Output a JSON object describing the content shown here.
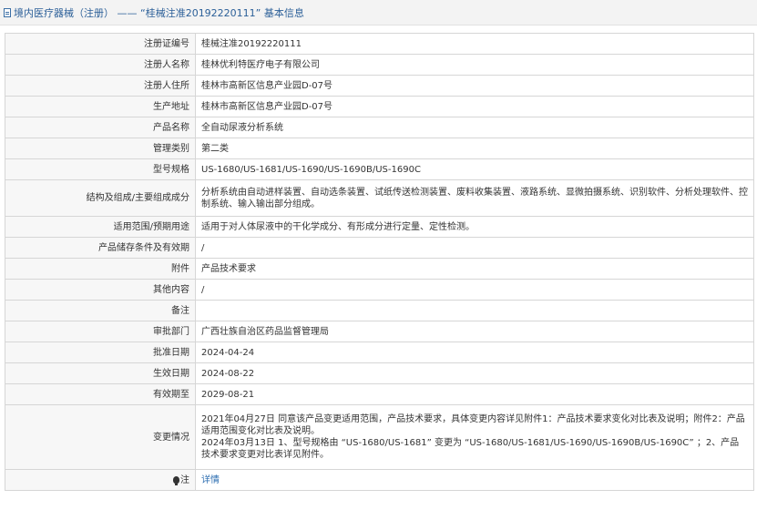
{
  "header": {
    "title": "境内医疗器械（注册） —— “桂械注准20192220111” 基本信息"
  },
  "rows": [
    {
      "label": "注册证编号",
      "value": "桂械注准20192220111"
    },
    {
      "label": "注册人名称",
      "value": "桂林优利特医疗电子有限公司"
    },
    {
      "label": "注册人住所",
      "value": "桂林市高新区信息产业园D-07号"
    },
    {
      "label": "生产地址",
      "value": "桂林市高新区信息产业园D-07号"
    },
    {
      "label": "产品名称",
      "value": "全自动尿液分析系统"
    },
    {
      "label": "管理类别",
      "value": "第二类"
    },
    {
      "label": "型号规格",
      "value": "US-1680/US-1681/US-1690/US-1690B/US-1690C"
    },
    {
      "label": "结构及组成/主要组成成分",
      "value": "分析系统由自动进样装置、自动选条装置、试纸传送检测装置、废料收集装置、液路系统、显微拍摄系统、识别软件、分析处理软件、控制系统、输入输出部分组成。"
    },
    {
      "label": "适用范围/预期用途",
      "value": "适用于对人体尿液中的干化学成分、有形成分进行定量、定性检测。"
    },
    {
      "label": "产品储存条件及有效期",
      "value": "/"
    },
    {
      "label": "附件",
      "value": "产品技术要求"
    },
    {
      "label": "其他内容",
      "value": "/"
    },
    {
      "label": "备注",
      "value": ""
    },
    {
      "label": "审批部门",
      "value": "广西壮族自治区药品监督管理局"
    },
    {
      "label": "批准日期",
      "value": "2024-04-24"
    },
    {
      "label": "生效日期",
      "value": "2024-08-22"
    },
    {
      "label": "有效期至",
      "value": "2029-08-21"
    },
    {
      "label": "变更情况",
      "value": "2021年04月27日 同意该产品变更适用范围，产品技术要求，具体变更内容详见附件1：产品技术要求变化对比表及说明；附件2：产品适用范围变化对比表及说明。\n2024年03月13日 1、型号规格由 “US-1680/US-1681” 变更为 “US-1680/US-1681/US-1690/US-1690B/US-1690C” ；2、产品技术要求变更对比表详见附件。"
    }
  ],
  "note_row": {
    "label": "注",
    "icon": "lightbulb-icon",
    "link": "详情"
  }
}
